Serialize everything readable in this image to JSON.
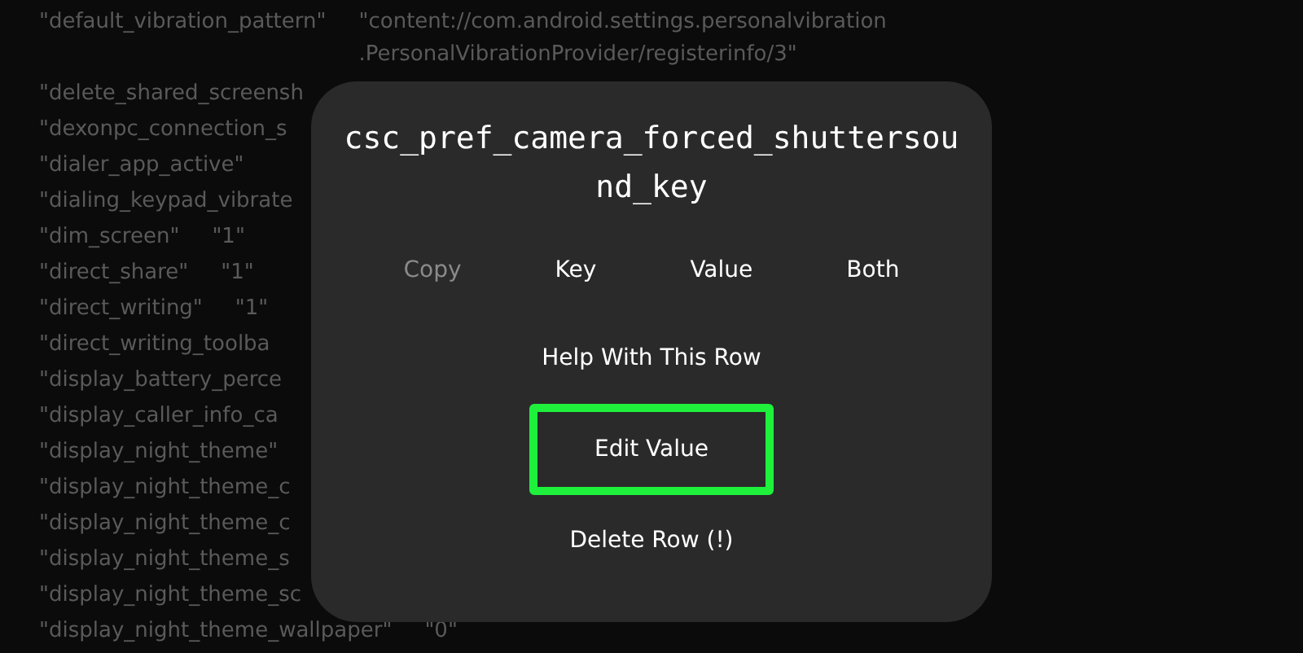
{
  "settings_list": [
    {
      "key": "\"default_vibration_pattern\"",
      "value": "\"content://com.android.settings.personalvibration\n.PersonalVibrationProvider/registerinfo/3\""
    },
    {
      "key": "\"delete_shared_screensh"
    },
    {
      "key": "\"dexonpc_connection_s"
    },
    {
      "key": "\"dialer_app_active\""
    },
    {
      "key": "\"dialing_keypad_vibrate"
    },
    {
      "key": "\"dim_screen\"",
      "value": "\"1\""
    },
    {
      "key": "\"direct_share\"",
      "value": "\"1\""
    },
    {
      "key": "\"direct_writing\"",
      "value": "\"1\""
    },
    {
      "key": "\"direct_writing_toolba"
    },
    {
      "key": "\"display_battery_perce"
    },
    {
      "key": "\"display_caller_info_ca"
    },
    {
      "key": "\"display_night_theme\""
    },
    {
      "key": "\"display_night_theme_c"
    },
    {
      "key": "\"display_night_theme_c"
    },
    {
      "key": "\"display_night_theme_s"
    },
    {
      "key": "\"display_night_theme_sc"
    },
    {
      "key": "\"display_night_theme_wallpaper\"",
      "value": "\"0\""
    }
  ],
  "dialog": {
    "title": "csc_pref_camera_forced_shuttersound_key",
    "copy_options": [
      {
        "label": "Copy",
        "kind": "label"
      },
      {
        "label": "Key",
        "kind": "button"
      },
      {
        "label": "Value",
        "kind": "button"
      },
      {
        "label": "Both",
        "kind": "button"
      }
    ],
    "actions": [
      {
        "label": "Help With This Row",
        "highlighted": false
      },
      {
        "label": "Edit Value",
        "highlighted": true
      },
      {
        "label": "Delete Row (!)",
        "highlighted": false
      }
    ]
  }
}
